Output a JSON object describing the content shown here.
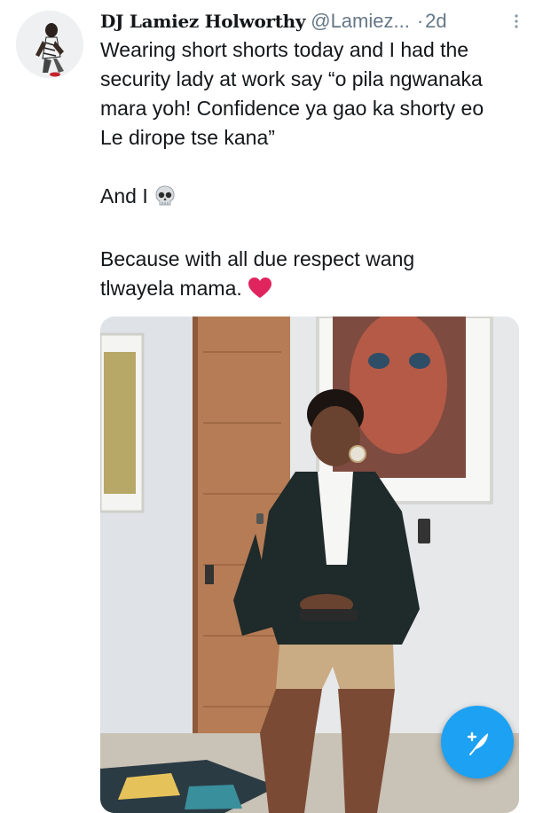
{
  "tweet": {
    "author_name": "DJ Lamiez Holworthy",
    "handle": "@Lamiez...",
    "separator": "·",
    "time": "2d",
    "lines": [
      "Wearing short shorts today and I had the",
      "security lady at work say “o pila ngwanaka",
      "mara yoh! Confidence ya gao ka shorty eo",
      "Le dirope tse kana”"
    ],
    "line_and_i": "And I",
    "lines_2": [
      "Because with all due respect wang",
      "tlwayela mama."
    ],
    "emoji_1": "skull-icon",
    "emoji_2": "red-heart-icon"
  },
  "icons": {
    "more": "more-vertical-icon",
    "compose": "compose-tweet-icon"
  },
  "colors": {
    "accent": "#1da1f2",
    "heart": "#e0245e",
    "secondary_text": "#657786"
  }
}
